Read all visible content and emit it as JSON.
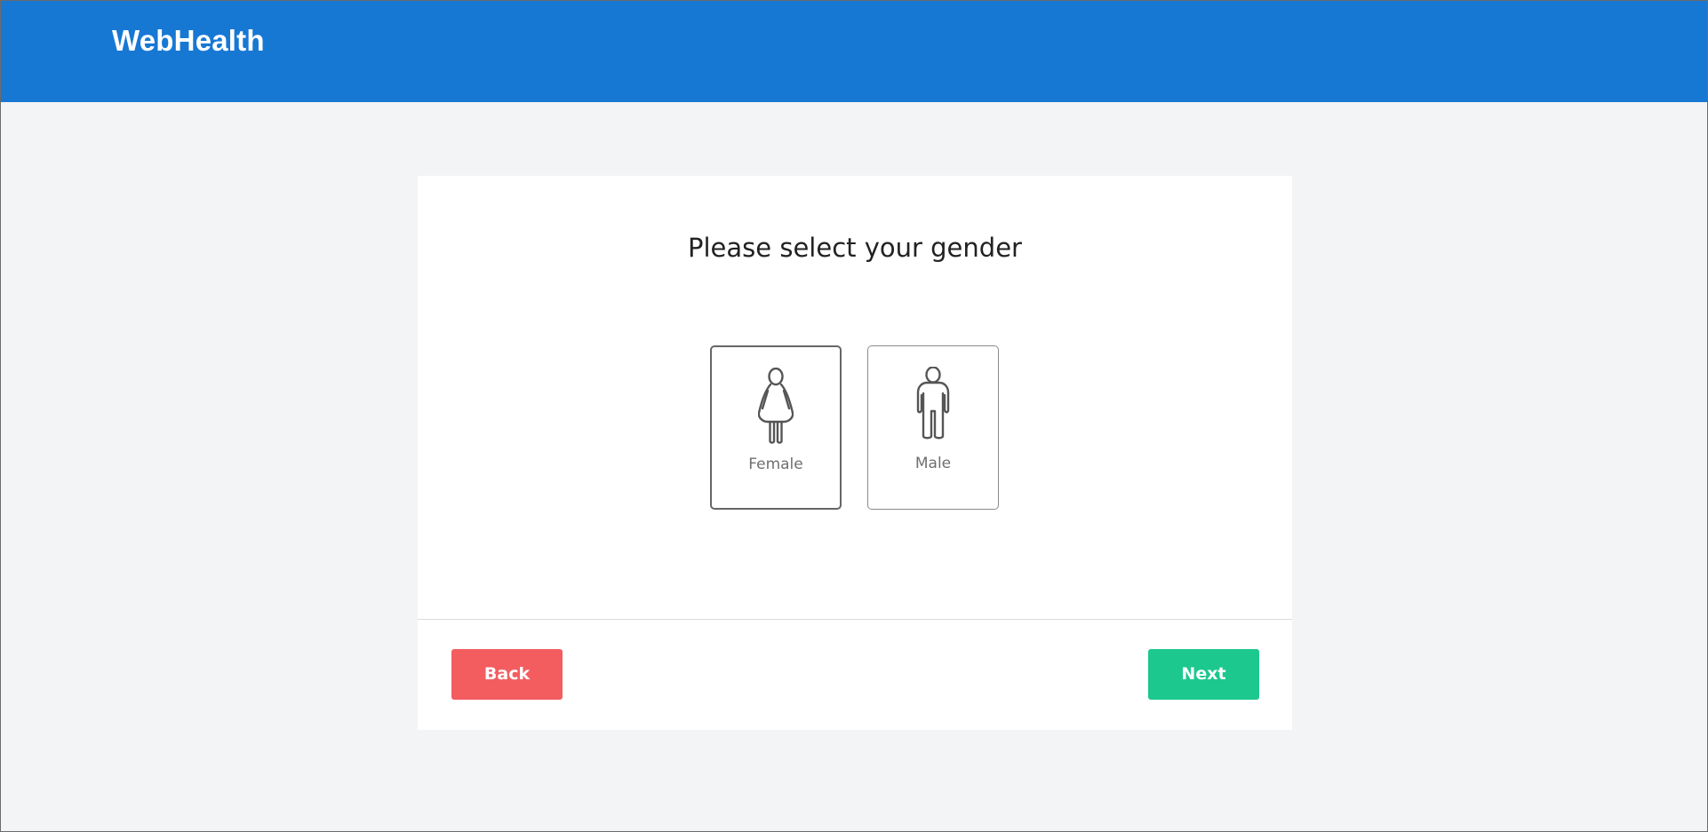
{
  "header": {
    "brand": "WebHealth"
  },
  "question": {
    "title": "Please select your gender"
  },
  "options": [
    {
      "label": "Female",
      "icon": "female-figure-icon",
      "selected": true
    },
    {
      "label": "Male",
      "icon": "male-figure-icon",
      "selected": false
    }
  ],
  "footer": {
    "back_label": "Back",
    "next_label": "Next"
  },
  "colors": {
    "header": "#1778d4",
    "back": "#f45d60",
    "next": "#1cc88e",
    "page_background": "#f3f4f6"
  }
}
